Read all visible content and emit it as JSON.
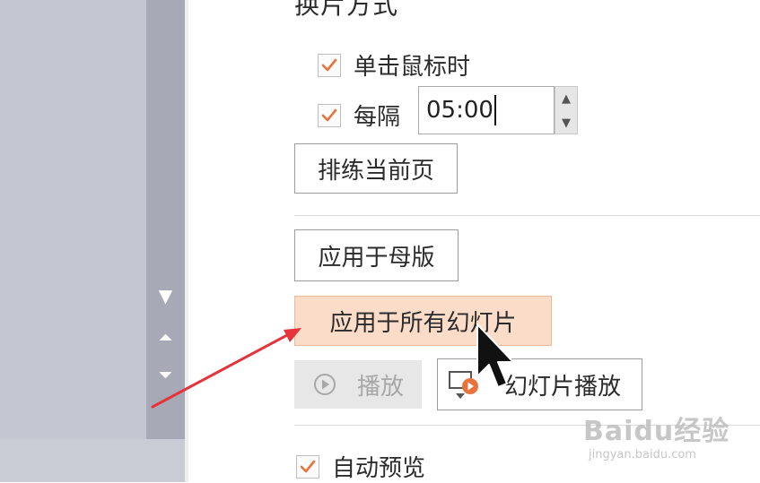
{
  "section": {
    "title": "换片方式"
  },
  "options": {
    "on_click_label": "单击鼠标时",
    "on_click_checked": true,
    "interval_label": "每隔",
    "interval_checked": true,
    "interval_value": "05:00"
  },
  "buttons": {
    "rehearse_label": "排练当前页",
    "apply_master_label": "应用于母版",
    "apply_all_label": "应用于所有幻灯片",
    "play_label": "播放",
    "slideshow_label": "幻灯片播放"
  },
  "preview": {
    "auto_preview_label": "自动预览",
    "auto_preview_checked": true
  },
  "navigation": {
    "down_glyph": "▼",
    "collapse_glyph": "⏶",
    "expand_glyph": "⏷"
  },
  "watermark": {
    "brand": "Baidu经验",
    "url": "jingyan.baidu.com"
  },
  "colors": {
    "accent_orange": "#e8743b",
    "highlight_fill": "#fbdcc8",
    "annotation_arrow": "#e5333b",
    "sidebar_gray": "#a7a9b6"
  },
  "icons": {
    "checkbox": "checkmark-icon",
    "play": "play-circle-icon",
    "slideshow": "slideshow-icon",
    "cursor": "mouse-pointer-icon",
    "annotation": "red-arrow-icon"
  }
}
